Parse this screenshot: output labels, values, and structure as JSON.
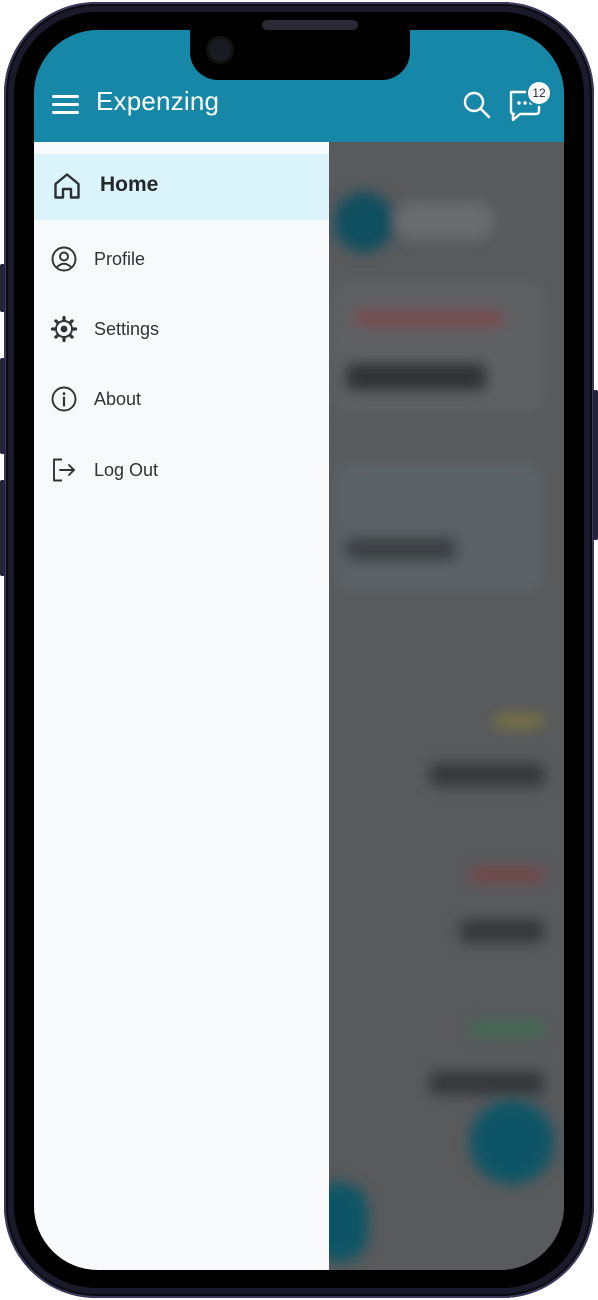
{
  "app": {
    "title": "Expenzing",
    "notification_count": "12"
  },
  "drawer": {
    "items": [
      {
        "label": "Home",
        "icon": "home-icon",
        "active": true
      },
      {
        "label": "Profile",
        "icon": "profile-icon",
        "active": false
      },
      {
        "label": "Settings",
        "icon": "gear-icon",
        "active": false
      },
      {
        "label": "About",
        "icon": "info-icon",
        "active": false
      },
      {
        "label": "Log Out",
        "icon": "logout-icon",
        "active": false
      }
    ]
  },
  "colors": {
    "accent": "#1687a7",
    "drawer_bg": "#f8f9fa",
    "active_item_bg": "#dbf3fa",
    "scrim": "#585a5c"
  }
}
